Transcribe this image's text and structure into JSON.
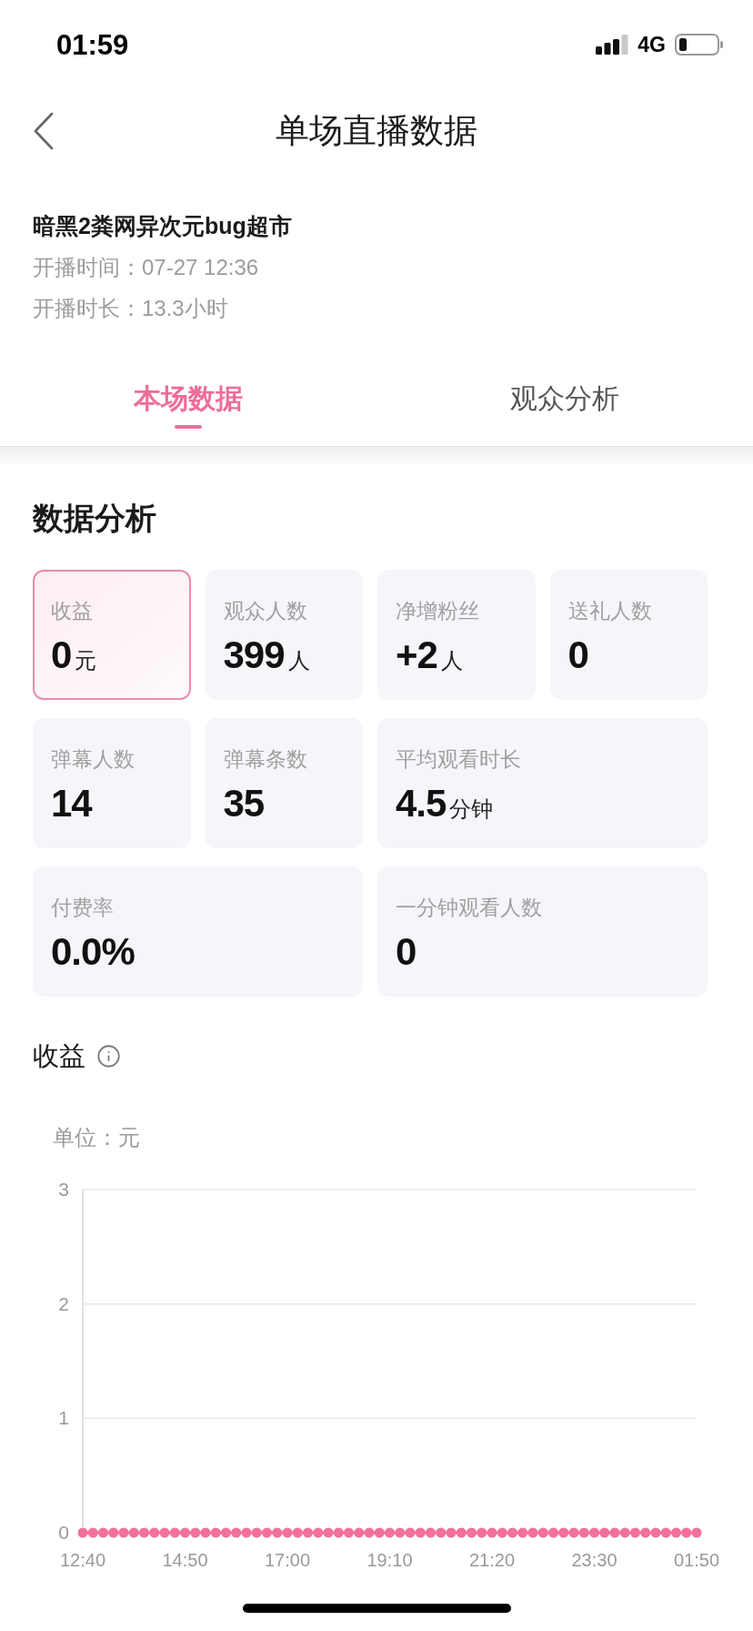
{
  "status_bar": {
    "time": "01:59",
    "network": "4G"
  },
  "header": {
    "title": "单场直播数据"
  },
  "stream": {
    "name": "暗黑2粪网异次元bug超市",
    "details": [
      {
        "label": "开播时间：",
        "value": "07-27 12:36"
      },
      {
        "label": "开播时长：",
        "value": "13.3小时"
      }
    ]
  },
  "tabs": [
    {
      "label": "本场数据",
      "selected": true
    },
    {
      "label": "观众分析",
      "selected": false
    }
  ],
  "data_analysis": {
    "title": "数据分析",
    "metric_rows": [
      [
        {
          "label": "收益",
          "value": "0",
          "unit": "元",
          "selected": true
        },
        {
          "label": "观众人数",
          "value": "399",
          "unit": "人",
          "selected": false
        },
        {
          "label": "净增粉丝",
          "value": "+2",
          "unit": "人",
          "selected": false
        },
        {
          "label": "送礼人数",
          "value": "0",
          "selected": false
        }
      ],
      [
        {
          "label": "弹幕人数",
          "value": "14",
          "selected": false
        },
        {
          "label": "弹幕条数",
          "value": "35",
          "selected": false
        },
        {
          "label": "平均观看时长",
          "value": "4.5",
          "unit": "分钟",
          "selected": false
        }
      ],
      [
        {
          "label": "付费率",
          "value": "0.0%",
          "selected": false
        },
        {
          "label": "一分钟观看人数",
          "value": "0",
          "selected": false
        }
      ]
    ]
  },
  "revenue": {
    "title": "收益",
    "chart_data": {
      "type": "line",
      "ylabel": "单位：元",
      "categories": [
        "12:40",
        null,
        null,
        null,
        null,
        null,
        null,
        null,
        null,
        null,
        "14:50",
        null,
        null,
        null,
        null,
        null,
        null,
        null,
        null,
        null,
        "17:00",
        null,
        null,
        null,
        null,
        null,
        null,
        null,
        null,
        null,
        "19:10",
        null,
        null,
        null,
        null,
        null,
        null,
        null,
        null,
        null,
        "21:20",
        null,
        null,
        null,
        null,
        null,
        null,
        null,
        null,
        null,
        "23:30",
        null,
        null,
        null,
        null,
        null,
        null,
        null,
        null,
        null,
        "01:50"
      ],
      "series": [
        {
          "color": "#f2709e",
          "marker": "circle",
          "values": [
            0,
            0,
            0,
            0,
            0,
            0,
            0,
            0,
            0,
            0,
            0,
            0,
            0,
            0,
            0,
            0,
            0,
            0,
            0,
            0,
            0,
            0,
            0,
            0,
            0,
            0,
            0,
            0,
            0,
            0,
            0,
            0,
            0,
            0,
            0,
            0,
            0,
            0,
            0,
            0,
            0,
            0,
            0,
            0,
            0,
            0,
            0,
            0,
            0,
            0,
            0,
            0,
            0,
            0,
            0,
            0,
            0,
            0,
            0,
            0,
            0
          ]
        }
      ],
      "ylim": [
        0,
        3
      ],
      "yticks": [
        0,
        1,
        2,
        3
      ]
    }
  }
}
